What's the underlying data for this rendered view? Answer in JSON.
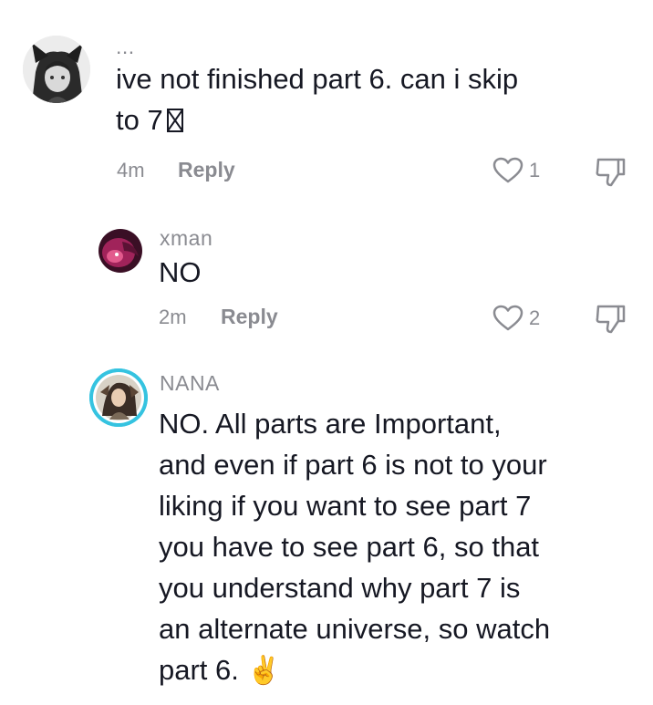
{
  "comments": [
    {
      "username": "...",
      "text_line1": "ive not finished part 6. can i skip",
      "text_line2": "to 7",
      "text_line2_glyph": "missing-glyph",
      "time": "4m",
      "reply_label": "Reply",
      "likes": "1"
    },
    {
      "username": "xman",
      "text": "NO",
      "time": "2m",
      "reply_label": "Reply",
      "likes": "2"
    },
    {
      "username": "NANA",
      "lines": [
        "NO. All parts are Important,",
        "and even if part 6 is not to your",
        "liking if you want to see part 7",
        "you have to see part 6, so that",
        "you understand why part 7 is",
        "an alternate universe, so watch",
        "part 6."
      ],
      "emoji": "✌️"
    }
  ],
  "icons": {
    "like": "heart-outline-icon",
    "dislike": "thumbs-down-outline-icon"
  },
  "colors": {
    "text": "#161823",
    "secondary": "#8a8b91",
    "nana_ring": "#35c3e0"
  }
}
